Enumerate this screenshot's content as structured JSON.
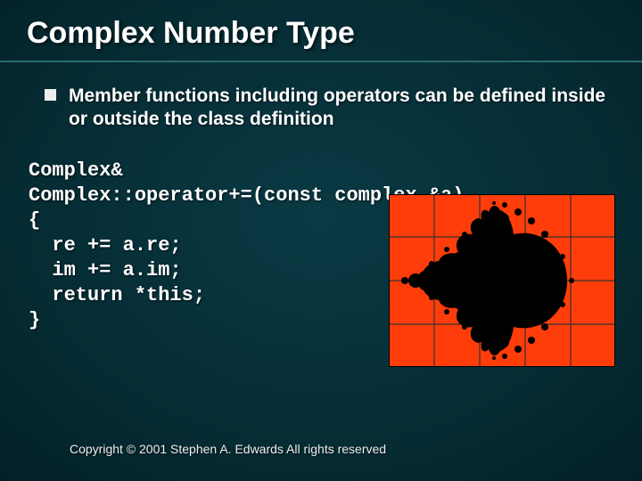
{
  "title": "Complex Number Type",
  "bullet": "Member functions including operators can be defined inside or outside the class definition",
  "code": "Complex&\nComplex::operator+=(const complex &a)\n{\n  re += a.re;\n  im += a.im;\n  return *this;\n}",
  "copyright": "Copyright © 2001 Stephen A. Edwards  All rights reserved",
  "fractal": {
    "name": "mandelbrot-fractal",
    "bg_color": "#ff3d0a",
    "fg_color": "#000000",
    "grid_color": "#333333"
  }
}
